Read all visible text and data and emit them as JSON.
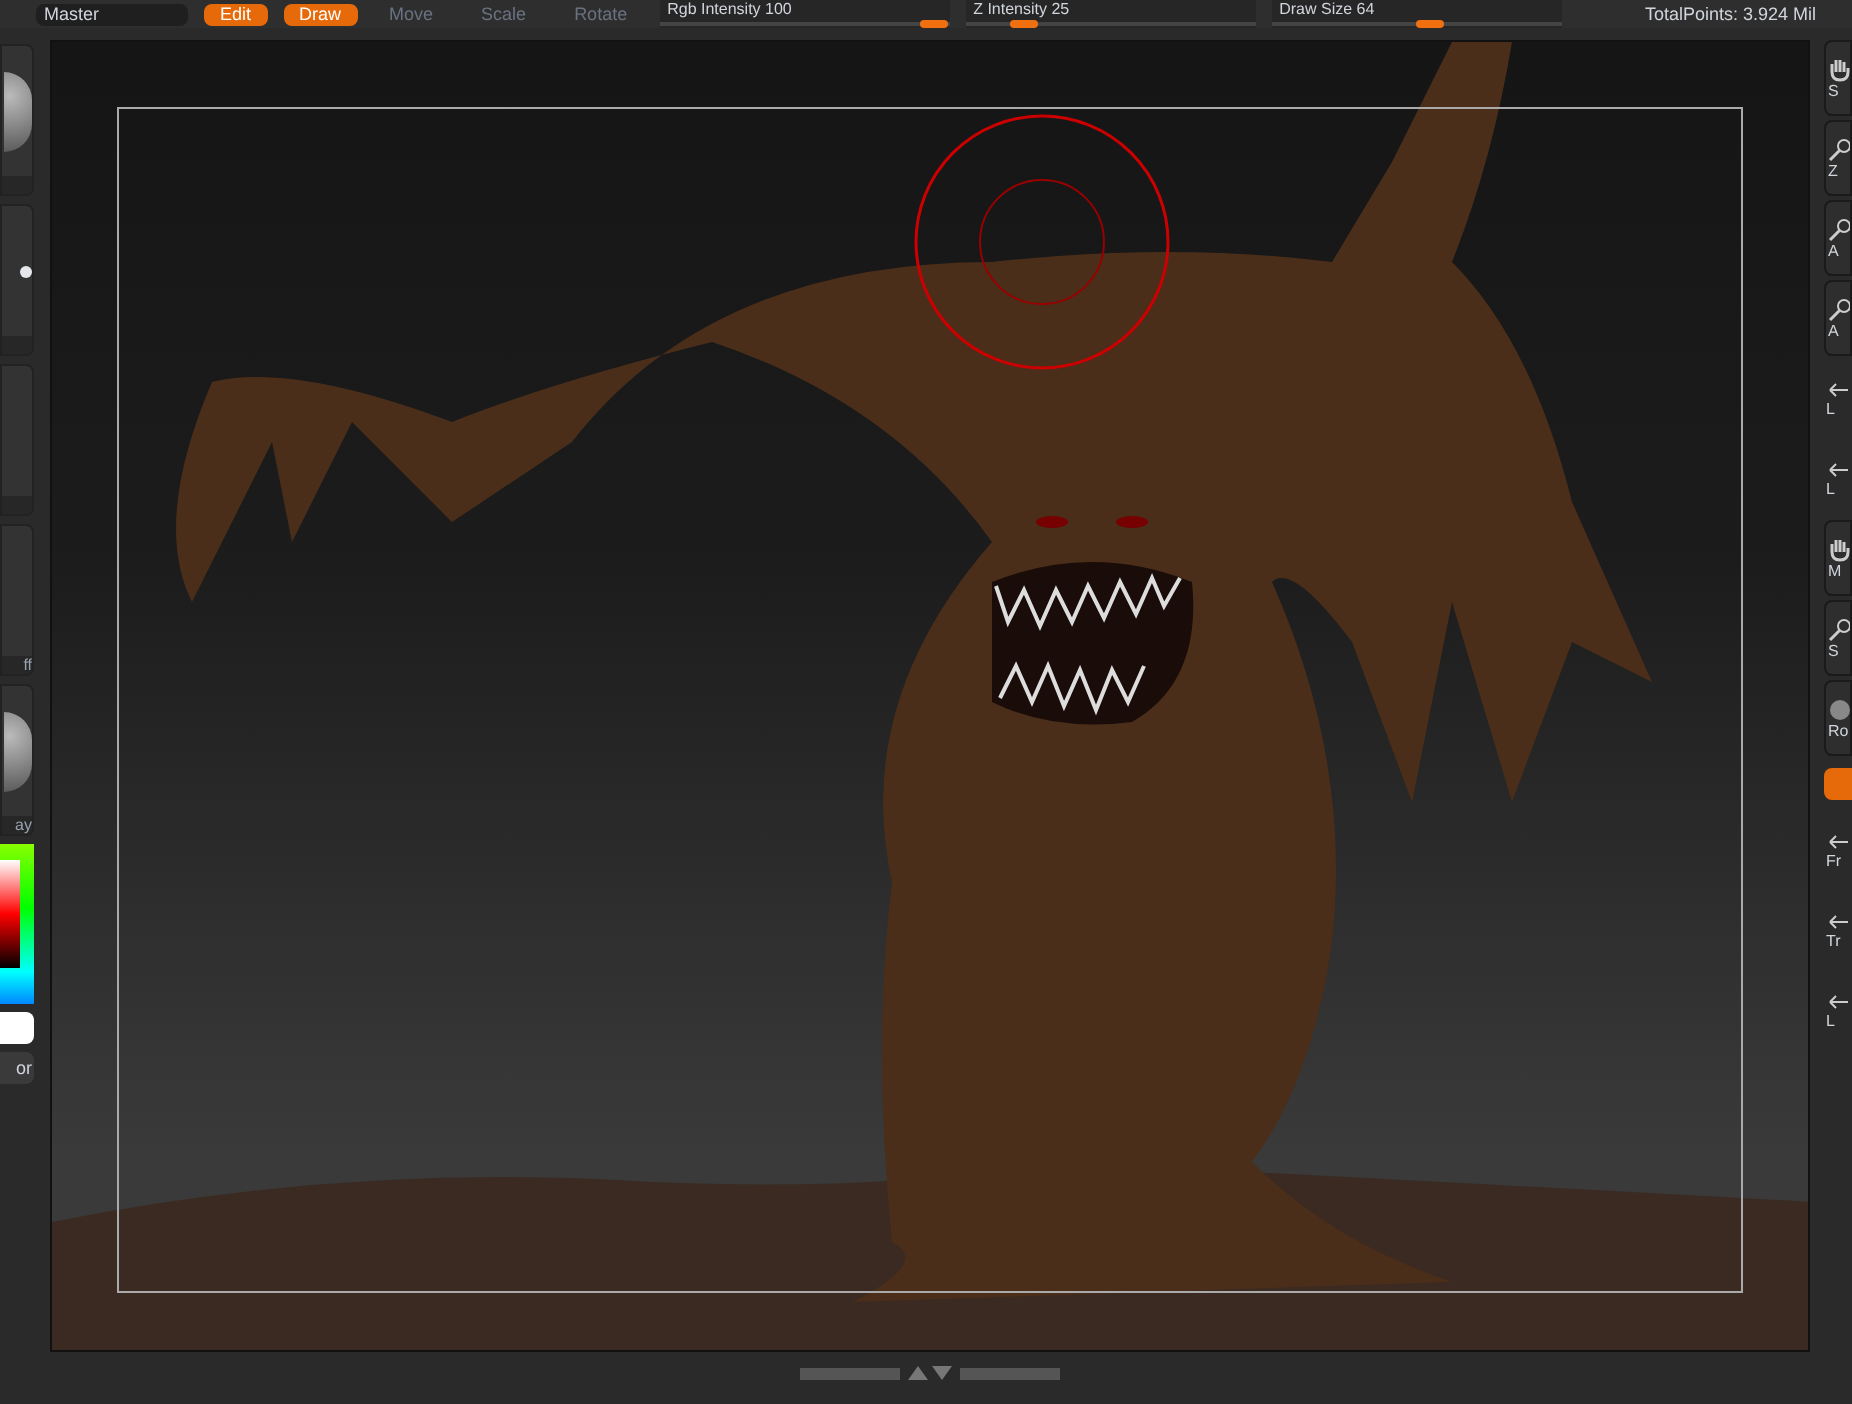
{
  "top_bar": {
    "menu": "Master",
    "modes": [
      {
        "label": "Edit",
        "selected": true
      },
      {
        "label": "Draw",
        "selected": true
      },
      {
        "label": "Move",
        "selected": false
      },
      {
        "label": "Scale",
        "selected": false
      },
      {
        "label": "Rotate",
        "selected": false
      }
    ],
    "sliders": [
      {
        "label": "Rgb Intensity 100",
        "level": 0.95
      },
      {
        "label": "Z Intensity 25",
        "level": 0.2
      },
      {
        "label": "Draw Size 64",
        "level": 0.55
      }
    ],
    "total_points": "TotalPoints: 3.924 Mil"
  },
  "left_shelf": [
    {
      "kind": "sphere"
    },
    {
      "kind": "dot"
    },
    {
      "kind": "blank"
    },
    {
      "kind": "blank",
      "label": "ff"
    },
    {
      "kind": "sphere",
      "label": "ay"
    },
    {
      "kind": "color",
      "label": "or"
    }
  ],
  "right_shelf": [
    {
      "kind": "hand",
      "label": "S"
    },
    {
      "kind": "zoom",
      "label": "Z"
    },
    {
      "kind": "zoom",
      "label": "A"
    },
    {
      "kind": "zoom",
      "label": "A"
    },
    {
      "kind": "plain",
      "label": "L"
    },
    {
      "kind": "plain",
      "label": "L"
    },
    {
      "kind": "hand",
      "label": "M"
    },
    {
      "kind": "zoom",
      "label": "S"
    },
    {
      "kind": "rotate",
      "label": "Ro"
    },
    {
      "kind": "toggle"
    },
    {
      "kind": "plain",
      "label": "Fr"
    },
    {
      "kind": "plain",
      "label": "Tr"
    },
    {
      "kind": "plain",
      "label": "L"
    }
  ]
}
